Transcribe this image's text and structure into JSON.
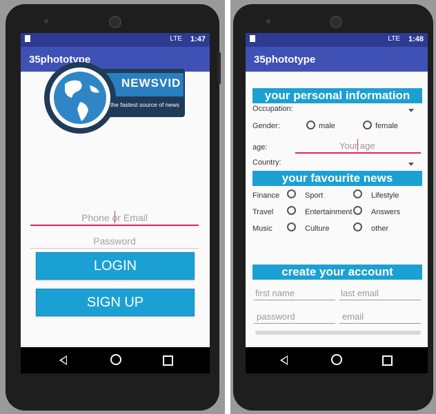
{
  "left_screen": {
    "status_time": "1:47",
    "status_signal": "LTE",
    "app_title": "35phototype",
    "logo": {
      "brand": "NEWSVID",
      "tagline": "the fastest source of news"
    },
    "phone_email_placeholder": "Phone or Email",
    "password_placeholder": "Password",
    "login_label": "LOGIN",
    "signup_label": "SIGN UP"
  },
  "right_screen": {
    "status_time": "1:48",
    "status_signal": "LTE",
    "app_title": "35phototype",
    "personal_section_title": "your personal information",
    "occupation_label": "Occupation:",
    "gender_label": "Gender:",
    "gender_options": [
      "male",
      "female"
    ],
    "age_label": "age:",
    "age_placeholder": "Your age",
    "country_label": "Country:",
    "news_section_title": "your favourite news",
    "news_options": [
      [
        "Finance",
        "Sport",
        "Lifestyle"
      ],
      [
        "Travel",
        "Entertainment",
        "Answers"
      ],
      [
        "Music",
        "Culture",
        "other"
      ]
    ],
    "account_section_title": "create your account",
    "first_name_placeholder": "first name",
    "last_email_placeholder": "last email",
    "password_placeholder": "password",
    "email_placeholder": "email"
  },
  "colors": {
    "status_bar": "#2e3b93",
    "app_bar": "#3f51b5",
    "button_blue": "#1ba0d4",
    "accent_pink": "#e91e63"
  }
}
